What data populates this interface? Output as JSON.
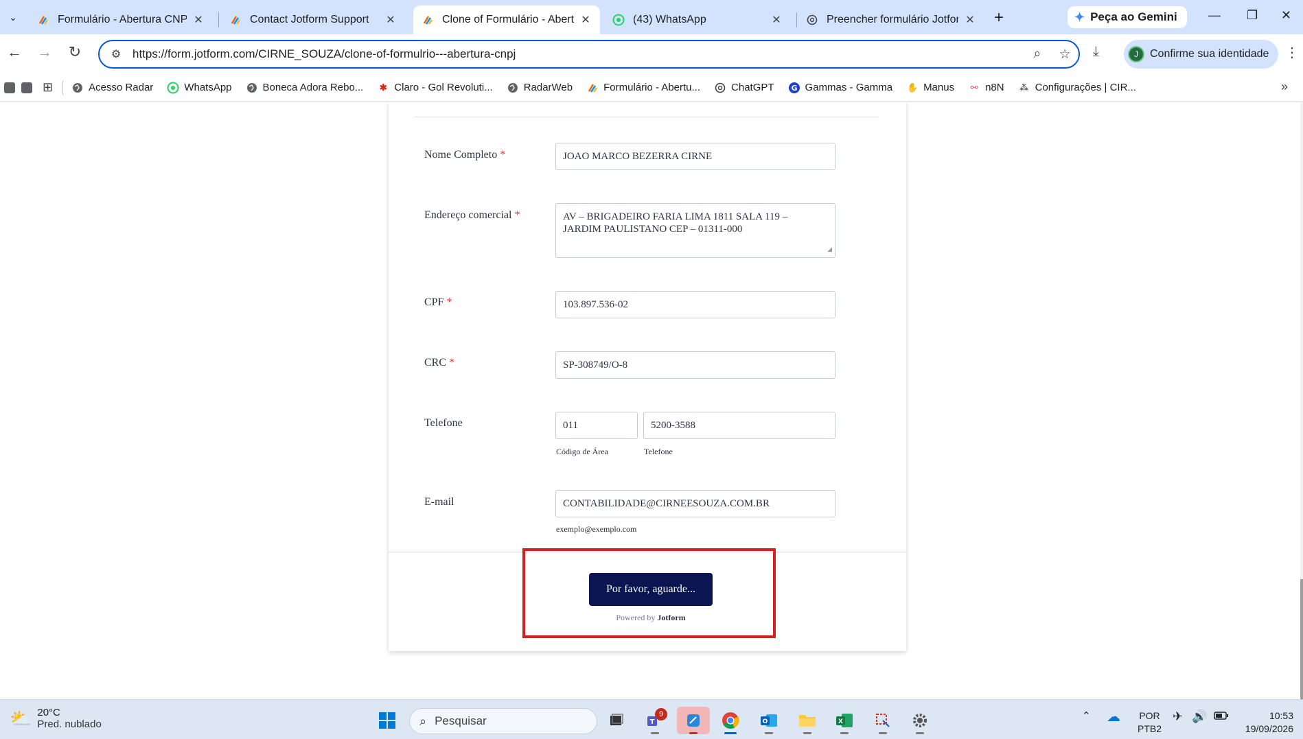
{
  "browser": {
    "tabs": [
      {
        "title": "Formulário - Abertura CNPJ -",
        "active": false
      },
      {
        "title": "Contact Jotform Support",
        "active": false
      },
      {
        "title": "Clone of Formulário - Abertu",
        "active": true
      },
      {
        "title": "(43) WhatsApp",
        "active": false
      },
      {
        "title": "Preencher formulário Jotform",
        "active": false
      }
    ],
    "gemini_label": "Peça ao Gemini",
    "url": "https://form.jotform.com/CIRNE_SOUZA/clone-of-formulrio---abertura-cnpj",
    "identity_label": "Confirme sua identidade",
    "identity_initial": "J",
    "bookmarks": [
      {
        "label": "Acesso Radar",
        "icon": "globe-icon"
      },
      {
        "label": "WhatsApp",
        "icon": "whatsapp-icon"
      },
      {
        "label": "Boneca Adora Rebo...",
        "icon": "globe-icon"
      },
      {
        "label": "Claro - Gol Revoluti...",
        "icon": "claro-icon"
      },
      {
        "label": "RadarWeb",
        "icon": "globe-icon"
      },
      {
        "label": "Formulário - Abertu...",
        "icon": "jotform-icon"
      },
      {
        "label": "ChatGPT",
        "icon": "chatgpt-icon"
      },
      {
        "label": "Gammas - Gamma",
        "icon": "gamma-icon"
      },
      {
        "label": "Manus",
        "icon": "manus-icon"
      },
      {
        "label": "n8N",
        "icon": "n8n-icon"
      },
      {
        "label": "Configurações | CIR...",
        "icon": "config-icon"
      }
    ]
  },
  "form": {
    "nome": {
      "label": "Nome Completo",
      "required": "*",
      "value": "JOAO MARCO BEZERRA CIRNE"
    },
    "endereco": {
      "label": "Endereço comercial",
      "required": "*",
      "line1": "AV – BRIGADEIRO FARIA LIMA 1811 SALA 119 –",
      "line2": "JARDIM PAULISTANO CEP – 01311-000"
    },
    "cpf": {
      "label": "CPF",
      "required": "*",
      "value": "103.897.536-02"
    },
    "crc": {
      "label": "CRC",
      "required": "*",
      "value": "SP-308749/O-8"
    },
    "telefone": {
      "label": "Telefone",
      "area_value": "011",
      "number_value": "5200-3588",
      "area_sublabel": "Código de Área",
      "number_sublabel": "Telefone"
    },
    "email": {
      "label": "E-mail",
      "value": "CONTABILIDADE@CIRNEESOUZA.COM.BR",
      "sublabel": "exemplo@exemplo.com"
    },
    "submit_label": "Por favor, aguarde...",
    "powered_prefix": "Powered by",
    "powered_brand": "Jotform"
  },
  "taskbar": {
    "temperature": "20°C",
    "weather_desc": "Pred. nublado",
    "search_placeholder": "Pesquisar",
    "teams_badge": "9",
    "lang_line1": "POR",
    "lang_line2": "PTB2",
    "time": "10:53",
    "date": "19/09/2026"
  },
  "colors": {
    "accent": "#0b57d0",
    "submit_bg": "#0a1551",
    "required": "#e33a3a",
    "highlight": "#d62020"
  }
}
